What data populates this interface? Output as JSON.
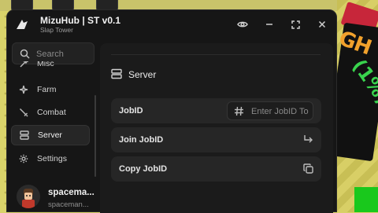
{
  "window": {
    "title": "MizuHub | ST v0.1",
    "subtitle": "Slap Tower"
  },
  "search": {
    "placeholder": "Search"
  },
  "sidebar": {
    "items": [
      {
        "label": "Misc",
        "icon": "wand-icon",
        "active": false
      },
      {
        "label": "Farm",
        "icon": "sparkle-icon",
        "active": false
      },
      {
        "label": "Combat",
        "icon": "sword-icon",
        "active": false
      },
      {
        "label": "Server",
        "icon": "server-icon",
        "active": true
      },
      {
        "label": "Settings",
        "icon": "gear-icon",
        "active": false
      }
    ]
  },
  "user": {
    "name": "spacema...",
    "handle": "spaceman..."
  },
  "content": {
    "section_title": "Server",
    "rows": {
      "jobid_label": "JobID",
      "jobid_placeholder": "Enter JobID To",
      "join_label": "Join JobID",
      "copy_label": "Copy JobID"
    }
  },
  "background": {
    "sign_text": "GH",
    "sign_percent": "(1%)"
  },
  "colors": {
    "window_bg": "#161616",
    "panel_bg": "#1b1b1b",
    "row_bg": "#262626",
    "text": "#e6e6e6"
  }
}
